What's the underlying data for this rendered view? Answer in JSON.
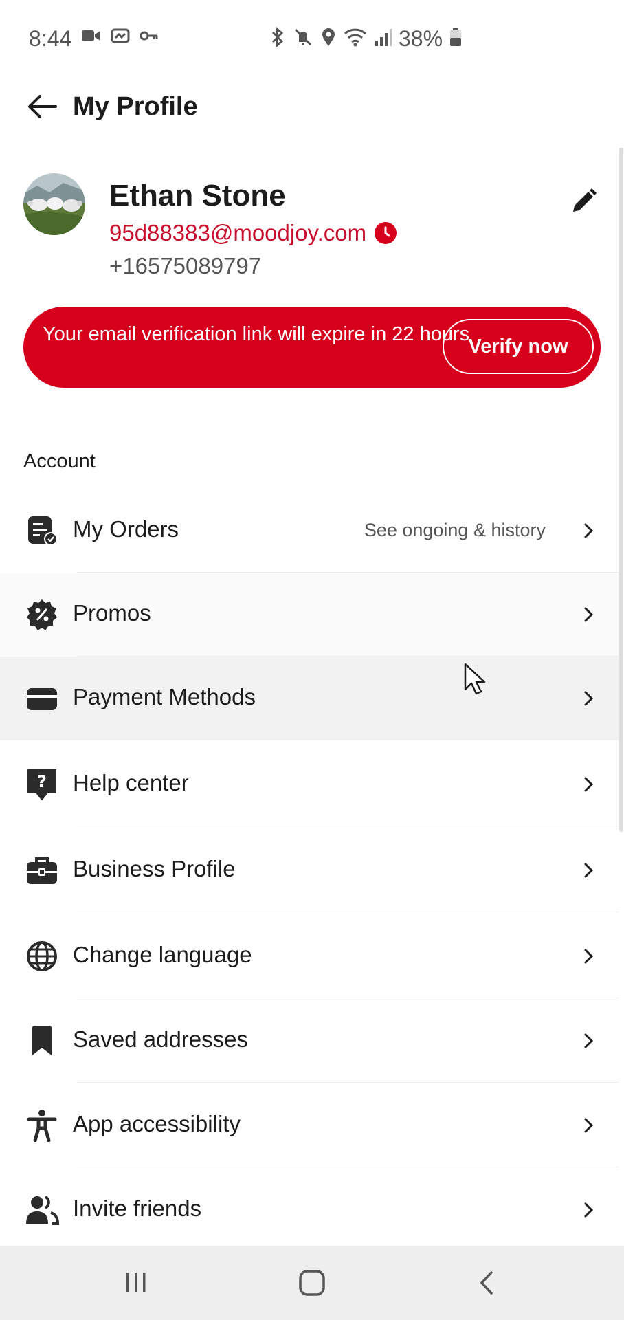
{
  "status_bar": {
    "time": "8:44",
    "battery": "38%",
    "icons": [
      "video-icon",
      "cast-icon",
      "key-icon",
      "bluetooth-icon",
      "mute-icon",
      "location-icon",
      "wifi-icon",
      "signal-icon",
      "battery-icon"
    ]
  },
  "header": {
    "title": "My Profile",
    "back_icon": "back-arrow-icon"
  },
  "profile": {
    "name": "Ethan Stone",
    "email": "95d88383@moodjoy.com",
    "phone": "+16575089797",
    "pending_icon": "clock-icon",
    "edit_icon": "pencil-icon"
  },
  "banner": {
    "message": "Your email verification link will expire in 22 hours",
    "button_label": "Verify now",
    "color": "#d6001c"
  },
  "account": {
    "section_title": "Account",
    "items": [
      {
        "label": "My Orders",
        "sub": "See ongoing & history",
        "icon": "orders-icon"
      },
      {
        "label": "Promos",
        "sub": "",
        "icon": "promo-icon"
      },
      {
        "label": "Payment Methods",
        "sub": "",
        "icon": "wallet-icon"
      },
      {
        "label": "Help center",
        "sub": "",
        "icon": "help-icon"
      },
      {
        "label": "Business Profile",
        "sub": "",
        "icon": "briefcase-icon"
      },
      {
        "label": "Change language",
        "sub": "",
        "icon": "globe-icon"
      },
      {
        "label": "Saved addresses",
        "sub": "",
        "icon": "bookmark-icon"
      },
      {
        "label": "App accessibility",
        "sub": "",
        "icon": "accessibility-icon"
      },
      {
        "label": "Invite friends",
        "sub": "",
        "icon": "friends-icon"
      }
    ]
  },
  "nav": {
    "icons": [
      "recent-apps-icon",
      "home-icon",
      "back-icon"
    ]
  },
  "colors": {
    "accent": "#d6001c",
    "email_text": "#c8102e",
    "active_row": "#f2f2f2"
  }
}
